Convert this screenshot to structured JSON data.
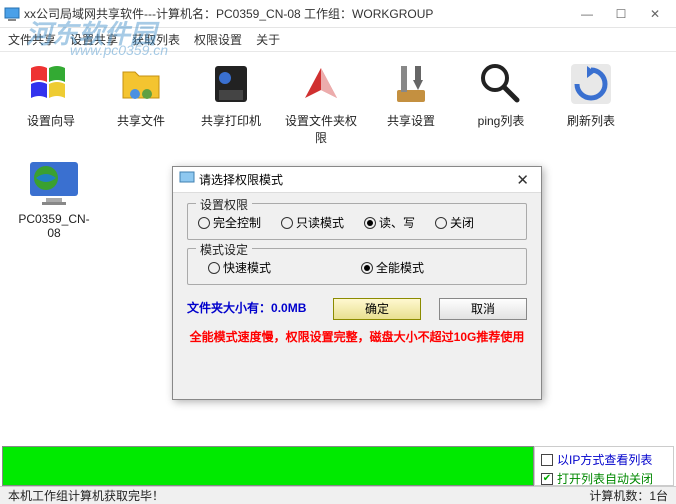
{
  "window": {
    "title": "xx公司局域网共享软件---计算机名：PC0359_CN-08 工作组：WORKGROUP"
  },
  "menu": {
    "items": [
      "文件共享",
      "设置共享",
      "获取列表",
      "权限设置",
      "关于"
    ]
  },
  "watermark": {
    "line1": "河东软件园",
    "line2": "www.pc0359.cn"
  },
  "toolbar": {
    "items": [
      {
        "label": "设置向导"
      },
      {
        "label": "共享文件"
      },
      {
        "label": "共享打印机"
      },
      {
        "label": "设置文件夹权限"
      },
      {
        "label": "共享设置"
      },
      {
        "label": "ping列表"
      },
      {
        "label": "刷新列表"
      }
    ]
  },
  "drives": [
    {
      "label": "PC0359_CN-08"
    }
  ],
  "dialog": {
    "title": "请选择权限模式",
    "fieldset1": {
      "legend": "设置权限",
      "options": [
        "完全控制",
        "只读模式",
        "读、写",
        "关闭"
      ],
      "selected": 2
    },
    "fieldset2": {
      "legend": "模式设定",
      "options": [
        "快速模式",
        "全能模式"
      ],
      "selected": 1
    },
    "file_size_label": "文件夹大小有：",
    "file_size_value": "0.0MB",
    "ok": "确定",
    "cancel": "取消",
    "warning": "全能模式速度慢，权限设置完整，磁盘大小不超过10G推荐使用"
  },
  "bottom": {
    "check_ip": "以IP方式查看列表",
    "check_auto": "打开列表自动关闭"
  },
  "status": {
    "left": "本机工作组计算机获取完毕！",
    "right": "计算机数：1台"
  }
}
